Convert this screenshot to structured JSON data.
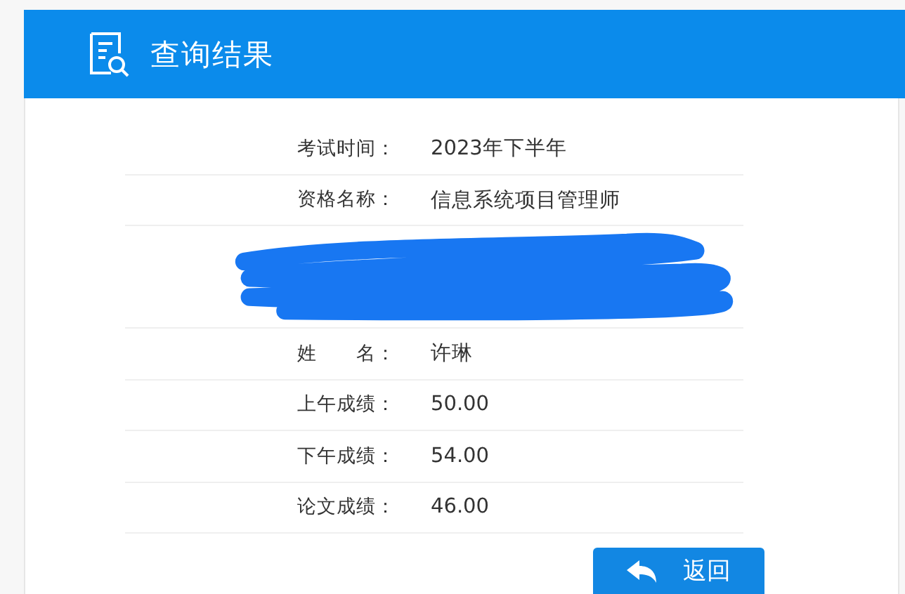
{
  "header": {
    "title": "查询结果"
  },
  "rows": [
    {
      "kind": "field",
      "label": "考试时间：",
      "value": "2023年下半年"
    },
    {
      "kind": "field",
      "label": "资格名称：",
      "value": "信息系统项目管理师"
    },
    {
      "kind": "redacted"
    },
    {
      "kind": "field",
      "label": "姓　　名：",
      "value": "许琳"
    },
    {
      "kind": "field",
      "label": "上午成绩：",
      "value": "50.00"
    },
    {
      "kind": "field",
      "label": "下午成绩：",
      "value": "54.00"
    },
    {
      "kind": "field",
      "label": "论文成绩：",
      "value": "46.00"
    }
  ],
  "back_button": {
    "label": "返回"
  }
}
